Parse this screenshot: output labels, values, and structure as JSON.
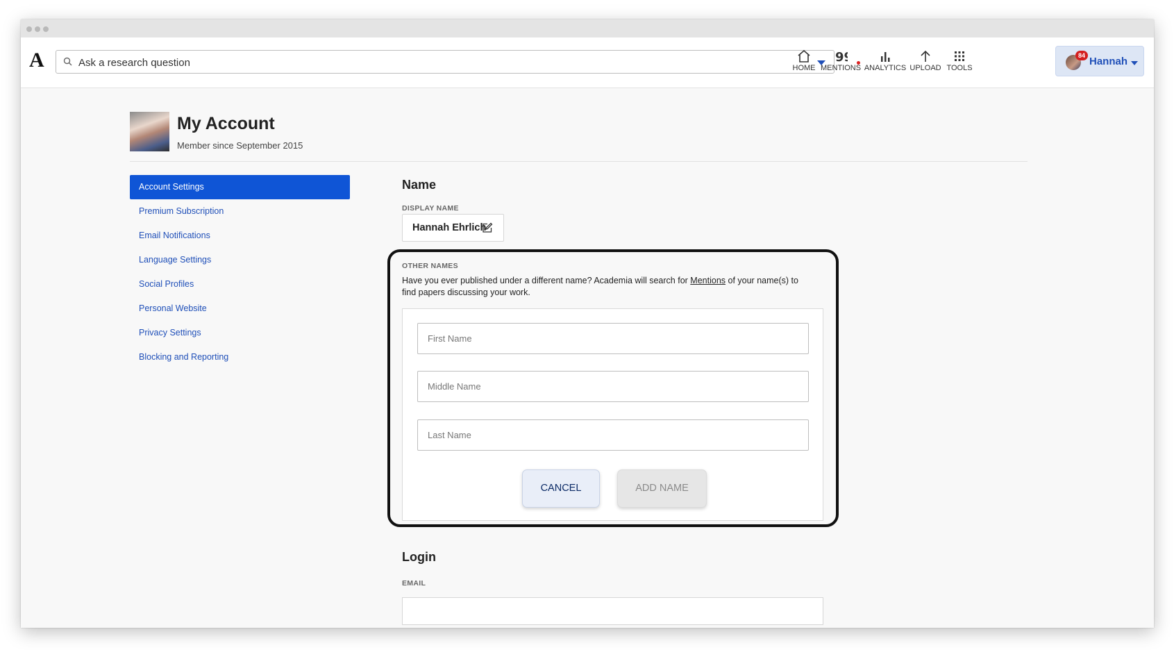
{
  "header": {
    "logo": "A",
    "search_placeholder": "Ask a research question",
    "nav": [
      {
        "label": "HOME",
        "icon": "home-icon"
      },
      {
        "label": "MENTIONS",
        "icon": "quote-icon"
      },
      {
        "label": "ANALYTICS",
        "icon": "bar-chart-icon"
      },
      {
        "label": "UPLOAD",
        "icon": "upload-arrow-icon"
      },
      {
        "label": "TOOLS",
        "icon": "grid-icon"
      }
    ],
    "user": {
      "name": "Hannah",
      "badge": "84"
    }
  },
  "profile": {
    "title": "My Account",
    "member_since": "Member since September 2015"
  },
  "sidebar": {
    "items": [
      {
        "label": "Account Settings",
        "active": true
      },
      {
        "label": "Premium Subscription"
      },
      {
        "label": "Email Notifications"
      },
      {
        "label": "Language Settings"
      },
      {
        "label": "Social Profiles"
      },
      {
        "label": "Personal Website"
      },
      {
        "label": "Privacy Settings"
      },
      {
        "label": "Blocking and Reporting"
      }
    ]
  },
  "name_section": {
    "title": "Name",
    "display_name_label": "DISPLAY NAME",
    "display_name": "Hannah Ehrlich",
    "other_names_label": "OTHER NAMES",
    "desc_before": "Have you ever published under a different name? Academia will search for ",
    "desc_link": "Mentions",
    "desc_after": " of your name(s) to find papers discussing your work.",
    "first_name_placeholder": "First Name",
    "middle_name_placeholder": "Middle Name",
    "last_name_placeholder": "Last Name",
    "cancel_label": "CANCEL",
    "add_name_label": "ADD NAME"
  },
  "login_section": {
    "title": "Login",
    "email_label": "EMAIL"
  },
  "colors": {
    "accent": "#0f55d6",
    "link": "#1f4fb8",
    "badge": "#d41f1f"
  }
}
